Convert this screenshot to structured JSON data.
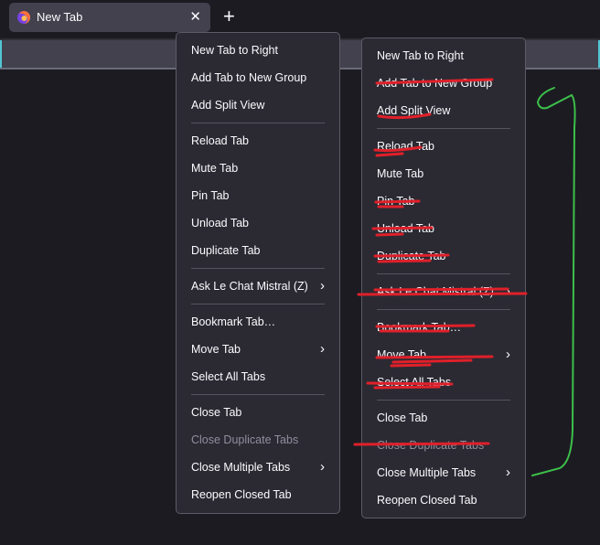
{
  "window": {
    "tab_title": "New Tab",
    "tab_favicon": "firefox-icon",
    "tab_close_glyph": "✕",
    "new_tab_glyph": "+"
  },
  "menu_left": {
    "items": [
      {
        "label": "New Tab to Right"
      },
      {
        "label": "Add Tab to New Group"
      },
      {
        "label": "Add Split View"
      },
      {
        "label": "Reload Tab"
      },
      {
        "label": "Mute Tab"
      },
      {
        "label": "Pin Tab"
      },
      {
        "label": "Unload Tab"
      },
      {
        "label": "Duplicate Tab"
      },
      {
        "label": "Ask Le Chat Mistral (Z)"
      },
      {
        "label": "Bookmark Tab…"
      },
      {
        "label": "Move Tab"
      },
      {
        "label": "Select All Tabs"
      },
      {
        "label": "Close Tab"
      },
      {
        "label": "Close Duplicate Tabs"
      },
      {
        "label": "Close Multiple Tabs"
      },
      {
        "label": "Reopen Closed Tab"
      }
    ]
  },
  "menu_right": {
    "items": [
      {
        "label": "New Tab to Right"
      },
      {
        "label": "Add Tab to New Group"
      },
      {
        "label": "Add Split View"
      },
      {
        "label": "Reload Tab"
      },
      {
        "label": "Mute Tab"
      },
      {
        "label": "Pin Tab"
      },
      {
        "label": "Unload Tab"
      },
      {
        "label": "Duplicate Tab"
      },
      {
        "label": "Ask Le Chat Mistral (Z)"
      },
      {
        "label": "Bookmark Tab…"
      },
      {
        "label": "Move Tab"
      },
      {
        "label": "Select All Tabs"
      },
      {
        "label": "Close Tab"
      },
      {
        "label": "Close Duplicate Tabs"
      },
      {
        "label": "Close Multiple Tabs"
      },
      {
        "label": "Reopen Closed Tab"
      }
    ]
  },
  "submenu_arrow": "›",
  "colors": {
    "background": "#1c1b22",
    "menu_bg": "#2b2a33",
    "annotation_red": "#e0202a",
    "annotation_green": "#3cc04a",
    "toolbar_accent": "#52c6d4"
  }
}
